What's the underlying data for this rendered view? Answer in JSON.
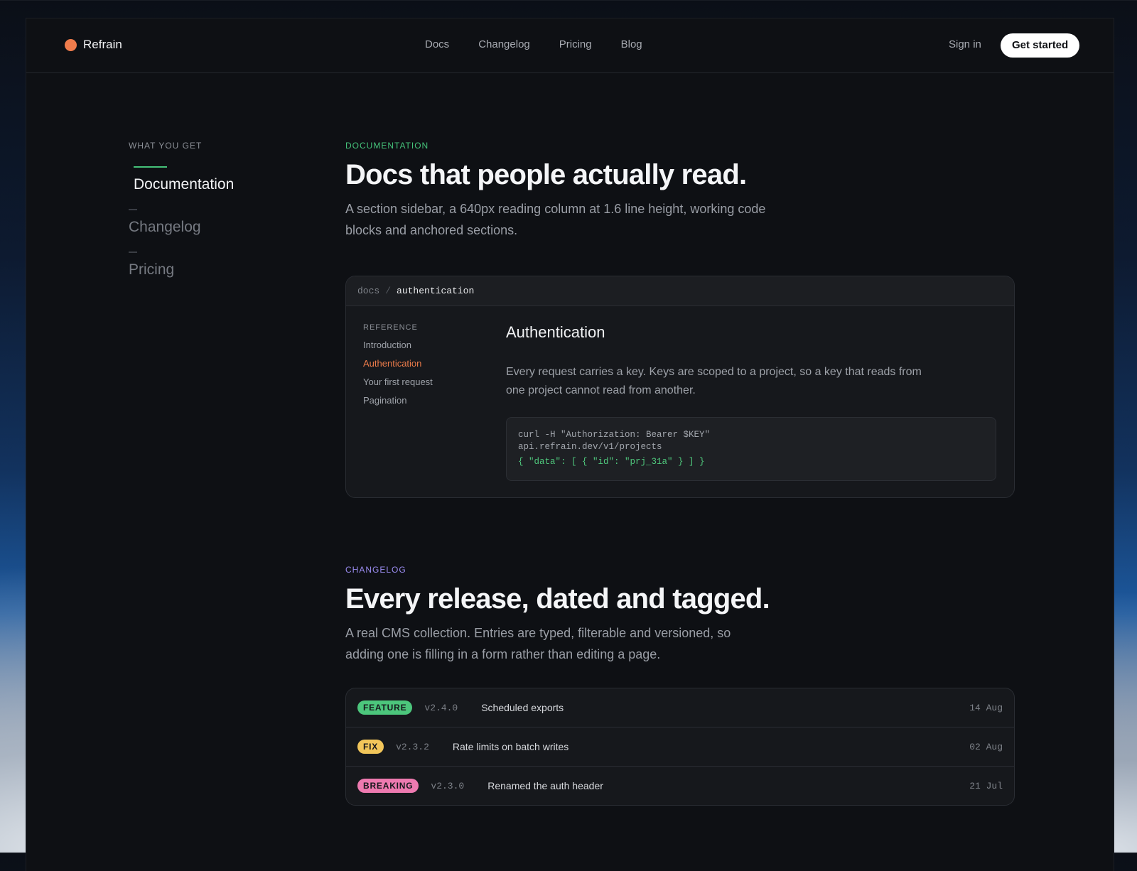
{
  "nav": {
    "brand": "Refrain",
    "links": [
      "Docs",
      "Changelog",
      "Pricing",
      "Blog"
    ],
    "signin": "Sign in",
    "cta": "Get started"
  },
  "sidebar": {
    "kicker": "WHAT YOU GET",
    "items": [
      {
        "label": "Documentation",
        "active": true
      },
      {
        "label": "Changelog",
        "active": false
      },
      {
        "label": "Pricing",
        "active": false
      }
    ]
  },
  "docs_section": {
    "kicker": "DOCUMENTATION",
    "kicker_color": "#45c27a",
    "title": "Docs that people actually read.",
    "lede": "A section sidebar, a 640px reading column at 1.6 line height, working code blocks and anchored sections.",
    "card": {
      "crumb_root": "docs",
      "crumb_sep": "/",
      "crumb_current": "authentication",
      "ref_label": "REFERENCE",
      "ref_links": [
        "Introduction",
        "Authentication",
        "Your first request",
        "Pagination"
      ],
      "active_index": 1,
      "heading": "Authentication",
      "body": "Every request carries a key. Keys are scoped to a project, so a key that reads from one project cannot read from another.",
      "code_line1": "curl -H \"Authorization: Bearer $KEY\"",
      "code_line2": "api.refrain.dev/v1/projects",
      "code_line3": "{ \"data\": [ { \"id\": \"prj_31a\" } ] }"
    }
  },
  "changelog_section": {
    "kicker": "CHANGELOG",
    "kicker_color": "#9a8cf0",
    "title": "Every release, dated and tagged.",
    "lede": "A real CMS collection. Entries are typed, filterable and versioned, so adding one is filling in a form rather than editing a page.",
    "entries": [
      {
        "tag": "FEATURE",
        "tag_color": "#4cc67c",
        "version": "v2.4.0",
        "title": "Scheduled exports",
        "date": "14 Aug"
      },
      {
        "tag": "FIX",
        "tag_color": "#f2c65a",
        "version": "v2.3.2",
        "title": "Rate limits on batch writes",
        "date": "02 Aug"
      },
      {
        "tag": "BREAKING",
        "tag_color": "#ee7ab0",
        "version": "v2.3.0",
        "title": "Renamed the auth header",
        "date": "21 Jul"
      }
    ]
  },
  "colors": {
    "accent_orange": "#f07c4c",
    "accent_green": "#45c27a"
  }
}
